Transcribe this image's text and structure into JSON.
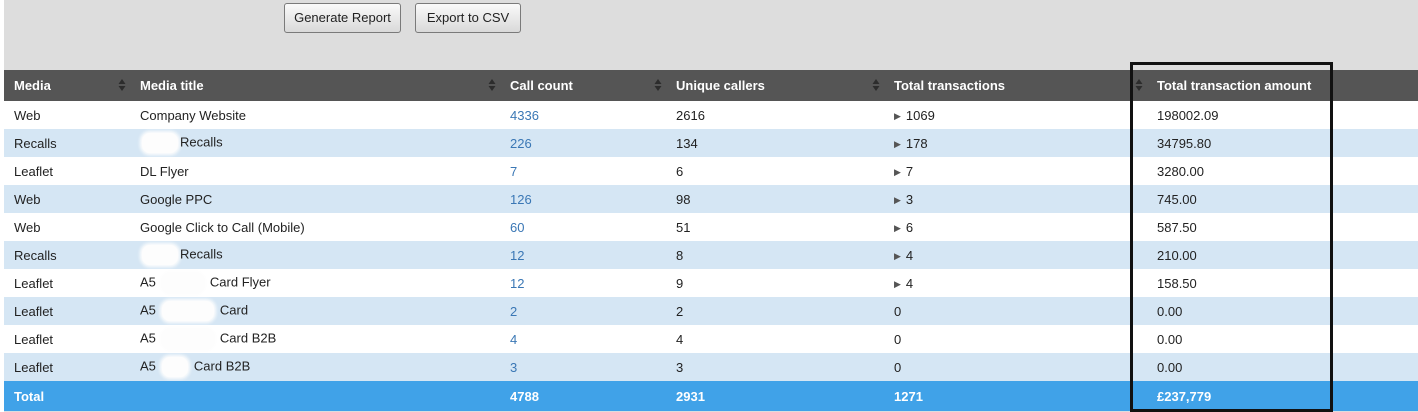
{
  "toolbar": {
    "generate_label": "Generate Report",
    "export_label": "Export to CSV"
  },
  "table": {
    "columns": [
      {
        "label": "Media",
        "sortable": true
      },
      {
        "label": "Media title",
        "sortable": true
      },
      {
        "label": "Call count",
        "sortable": true
      },
      {
        "label": "Unique callers",
        "sortable": true
      },
      {
        "label": "Total transactions",
        "sortable": true
      },
      {
        "label": "Total transaction amount",
        "sortable": false
      }
    ],
    "rows": [
      {
        "media": "Web",
        "title_pre": "Company Website",
        "title_post": "",
        "call_count": "4336",
        "unique_callers": "2616",
        "transactions": "1069",
        "expandable": true,
        "amount": "198002.09"
      },
      {
        "media": "Recalls",
        "title_pre": "",
        "title_post": "Recalls",
        "call_count": "226",
        "unique_callers": "134",
        "transactions": "178",
        "expandable": true,
        "amount": "34795.80"
      },
      {
        "media": "Leaflet",
        "title_pre": "DL Flyer",
        "title_post": "",
        "call_count": "7",
        "unique_callers": "6",
        "transactions": "7",
        "expandable": true,
        "amount": "3280.00"
      },
      {
        "media": "Web",
        "title_pre": "Google PPC",
        "title_post": "",
        "call_count": "126",
        "unique_callers": "98",
        "transactions": "3",
        "expandable": true,
        "amount": "745.00"
      },
      {
        "media": "Web",
        "title_pre": "Google Click to Call (Mobile)",
        "title_post": "",
        "call_count": "60",
        "unique_callers": "51",
        "transactions": "6",
        "expandable": true,
        "amount": "587.50"
      },
      {
        "media": "Recalls",
        "title_pre": "",
        "title_post": "Recalls",
        "call_count": "12",
        "unique_callers": "8",
        "transactions": "4",
        "expandable": true,
        "amount": "210.00"
      },
      {
        "media": "Leaflet",
        "title_pre": "A5",
        "title_post": "Card Flyer",
        "call_count": "12",
        "unique_callers": "9",
        "transactions": "4",
        "expandable": true,
        "amount": "158.50"
      },
      {
        "media": "Leaflet",
        "title_pre": "A5",
        "title_post": "Card",
        "call_count": "2",
        "unique_callers": "2",
        "transactions": "0",
        "expandable": false,
        "amount": "0.00"
      },
      {
        "media": "Leaflet",
        "title_pre": "A5",
        "title_post": "Card B2B",
        "call_count": "4",
        "unique_callers": "4",
        "transactions": "0",
        "expandable": false,
        "amount": "0.00"
      },
      {
        "media": "Leaflet",
        "title_pre": "A5",
        "title_post": "Card B2B",
        "call_count": "3",
        "unique_callers": "3",
        "transactions": "0",
        "expandable": false,
        "amount": "0.00"
      }
    ],
    "total": {
      "label": "Total",
      "call_count": "4788",
      "unique_callers": "2931",
      "transactions": "1271",
      "amount": "£237,779"
    }
  },
  "colors": {
    "header_bg": "#555555",
    "row_alt_bg": "#d5e6f4",
    "total_bg": "#40a2e8",
    "link": "#3a77b5",
    "highlight_border": "#111111"
  },
  "icons": {
    "sort": "sort-up-down-icon",
    "expand": "triangle-right-icon"
  }
}
